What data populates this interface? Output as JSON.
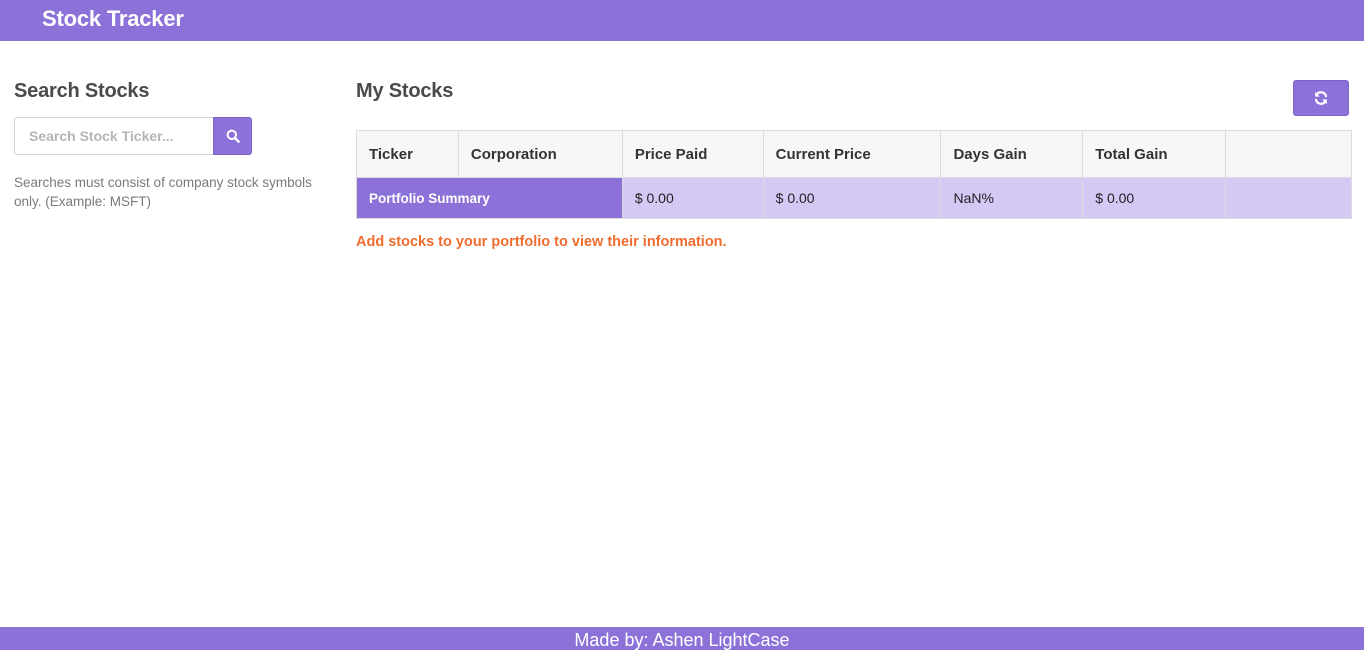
{
  "navbar": {
    "brand": "Stock Tracker"
  },
  "search": {
    "heading": "Search Stocks",
    "placeholder": "Search Stock Ticker...",
    "value": "",
    "button_icon": "search-icon",
    "help": "Searches must consist of company stock symbols only. (Example: MSFT)"
  },
  "portfolio": {
    "heading": "My Stocks",
    "refresh_icon": "refresh-icon",
    "columns": [
      "Ticker",
      "Corporation",
      "Price Paid",
      "Current Price",
      "Days Gain",
      "Total Gain",
      ""
    ],
    "summary": {
      "label": "Portfolio Summary",
      "price_paid": "$ 0.00",
      "current_price": "$ 0.00",
      "days_gain": "NaN%",
      "total_gain": "$ 0.00",
      "extra": ""
    },
    "notice": "Add stocks to your portfolio to view their information."
  },
  "footer": {
    "text": "Made by: Ashen LightCase"
  },
  "colors": {
    "accent": "#8c72d8",
    "summary_row": "#d4c8f5",
    "notice": "#ef6c2f"
  }
}
